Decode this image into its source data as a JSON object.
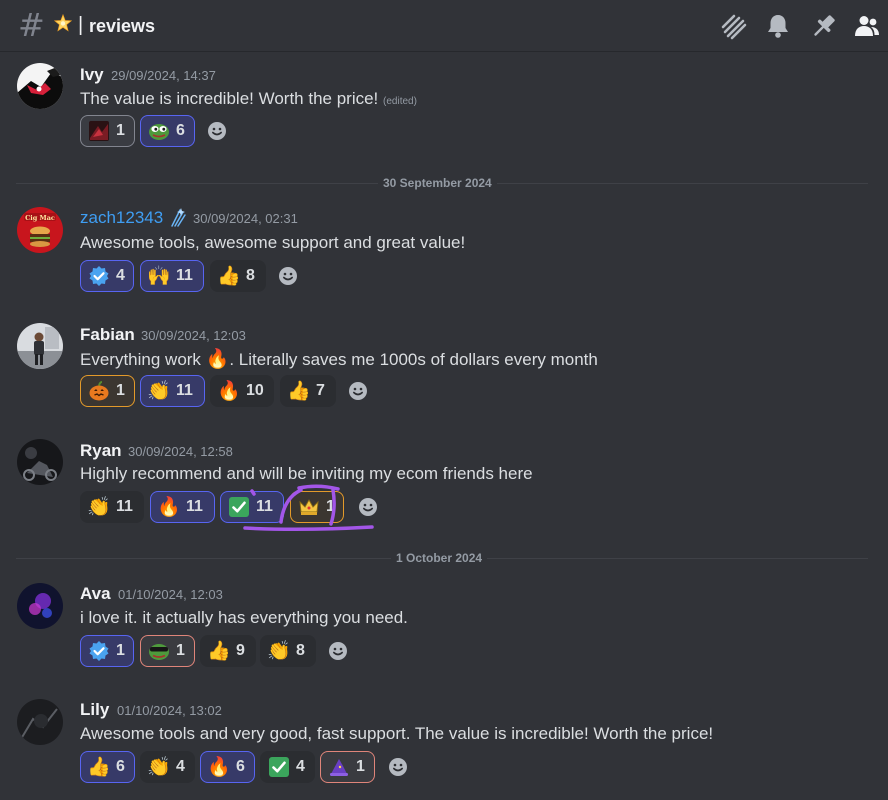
{
  "channel": {
    "emoji": "glowing-star",
    "separator": "|",
    "name": "reviews"
  },
  "header_icons": [
    "threads-icon",
    "bell-icon",
    "pin-icon",
    "members-icon"
  ],
  "dividers": [
    "30 September 2024",
    "1 October 2024"
  ],
  "messages": [
    {
      "user": "Ivy",
      "time": "29/09/2024, 14:37",
      "text": "The value is incredible! Worth the price!",
      "edited": "(edited)",
      "reactions": [
        {
          "emoji": "image-reaction",
          "count": "1"
        },
        {
          "emoji": "pepe-frog",
          "count": "6"
        }
      ]
    },
    {
      "user": "zach12343",
      "badge": "sparkles",
      "time": "30/09/2024, 02:31",
      "text": "Awesome tools, awesome support and great value!",
      "reactions": [
        {
          "emoji": "verified",
          "count": "4"
        },
        {
          "emoji": "raised-hands",
          "count": "11"
        },
        {
          "emoji": "thumbs-up",
          "count": "8"
        }
      ]
    },
    {
      "user": "Fabian",
      "time": "30/09/2024, 12:03",
      "text_before": "Everything work",
      "text_after": ". Literally saves me 1000s of dollars every month",
      "inline_emoji": "fire",
      "reactions": [
        {
          "emoji": "pumpkin",
          "count": "1"
        },
        {
          "emoji": "clapping-hands",
          "count": "11"
        },
        {
          "emoji": "fire",
          "count": "10"
        },
        {
          "emoji": "thumbs-up",
          "count": "7"
        }
      ]
    },
    {
      "user": "Ryan",
      "time": "30/09/2024, 12:58",
      "text": "Highly recommend and will be inviting my ecom friends here",
      "reactions": [
        {
          "emoji": "clapping-hands",
          "count": "11"
        },
        {
          "emoji": "fire",
          "count": "11"
        },
        {
          "emoji": "check-mark",
          "count": "11"
        },
        {
          "emoji": "crown",
          "count": "1"
        }
      ]
    },
    {
      "user": "Ava",
      "time": "01/10/2024, 12:03",
      "text": "i love it. it actually has everything you need.",
      "reactions": [
        {
          "emoji": "verified",
          "count": "1"
        },
        {
          "emoji": "pepe-frog",
          "count": "1"
        },
        {
          "emoji": "thumbs-up",
          "count": "9"
        },
        {
          "emoji": "clapping-hands",
          "count": "8"
        }
      ]
    },
    {
      "user": "Lily",
      "time": "01/10/2024, 13:02",
      "text": "Awesome tools and very good, fast support. The value is incredible! Worth the price!",
      "reactions": [
        {
          "emoji": "thumbs-up",
          "count": "6"
        },
        {
          "emoji": "clapping-hands",
          "count": "4"
        },
        {
          "emoji": "fire",
          "count": "6"
        },
        {
          "emoji": "check-mark",
          "count": "4"
        },
        {
          "emoji": "wizard-hat",
          "count": "1"
        }
      ]
    }
  ],
  "colors": {
    "background": "#313338",
    "blurple": "#5865f2",
    "link_blue": "#3f9ef3",
    "annotation_purple": "#a356e8"
  }
}
